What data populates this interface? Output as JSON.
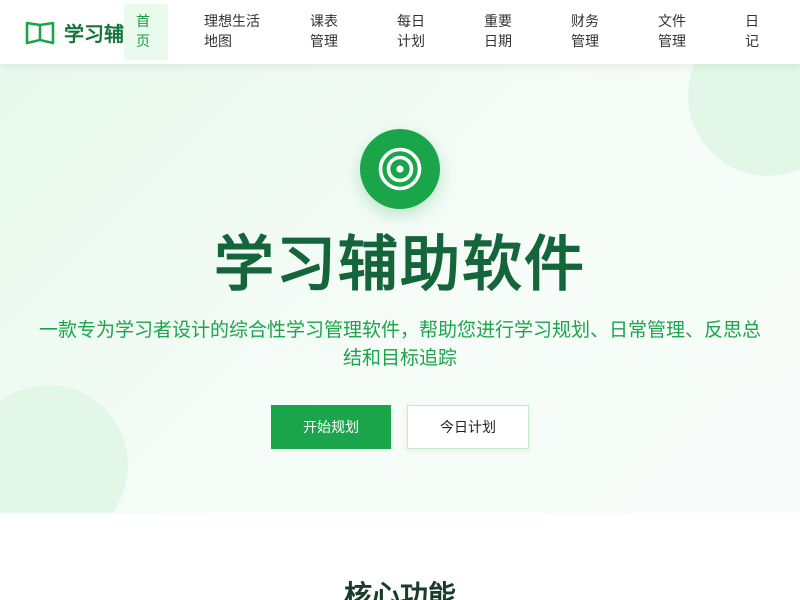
{
  "brand": {
    "name": "学习辅助软件",
    "icon": "open-book-icon",
    "color": "#1ba54a"
  },
  "nav": {
    "items": [
      {
        "line1": "首",
        "line2": "页",
        "active": true
      },
      {
        "line1": "理想生活",
        "line2": "地图"
      },
      {
        "line1": "课表",
        "line2": "管理"
      },
      {
        "line1": "每日",
        "line2": "计划"
      },
      {
        "line1": "重要",
        "line2": "日期"
      },
      {
        "line1": "财务",
        "line2": "管理"
      },
      {
        "line1": "文件",
        "line2": "管理"
      },
      {
        "line1": "日",
        "line2": "记"
      }
    ]
  },
  "hero": {
    "icon": "target-icon",
    "title": "学习辅助软件",
    "subtitle": "一款专为学习者设计的综合性学习管理软件，帮助您进行学习规划、日常管理、反思总结和目标追踪",
    "primary_button": "开始规划",
    "secondary_button": "今日计划"
  },
  "features": {
    "title": "核心功能"
  },
  "colors": {
    "accent": "#1ba54a",
    "title": "#15653a",
    "hero_bg": "#eefaf2"
  }
}
